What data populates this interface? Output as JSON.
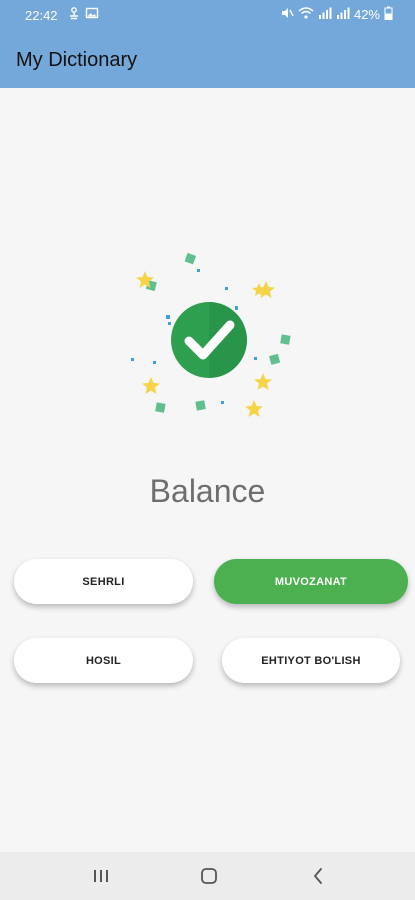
{
  "status_bar": {
    "time": "22:42",
    "battery_percent": "42%",
    "left_icons": [
      "usb-debug-icon",
      "image-icon"
    ],
    "right_icons": [
      "mute-icon",
      "wifi-icon",
      "signal-icon",
      "signal-icon",
      "battery-icon"
    ]
  },
  "app_bar": {
    "title": "My Dictionary"
  },
  "quiz": {
    "illustration": "success-checkmark-icon",
    "word": "Balance",
    "options": [
      {
        "label": "SEHRLI",
        "selected": false
      },
      {
        "label": "MUVOZANAT",
        "selected": true
      },
      {
        "label": "HOSIL",
        "selected": false
      },
      {
        "label": "EHTIYOT BO'LISH",
        "selected": false
      }
    ]
  },
  "nav_bar": {
    "buttons": [
      "recent-apps-icon",
      "home-icon",
      "back-icon"
    ]
  },
  "colors": {
    "app_bar": "#74a8da",
    "selected_option": "#4caf50",
    "check_circle": "#2e9e4f",
    "background": "#f6f6f6"
  }
}
